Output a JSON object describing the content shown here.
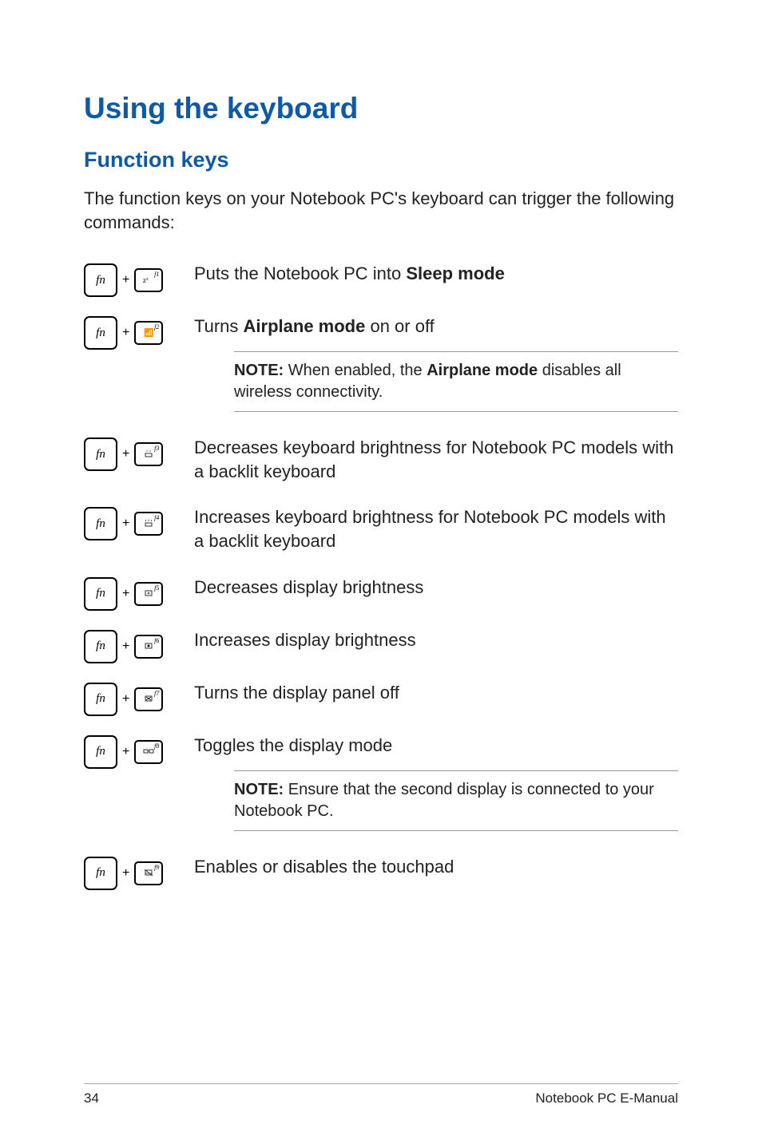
{
  "title": "Using the keyboard",
  "section_title": "Function keys",
  "intro": "The function keys on your Notebook PC's keyboard can trigger the following commands:",
  "rows": [
    {
      "fkey": "f1",
      "desc_prefix": "Puts the Notebook PC into ",
      "desc_bold": "Sleep mode",
      "desc_suffix": ""
    },
    {
      "fkey": "f2",
      "desc_prefix": "Turns ",
      "desc_bold": "Airplane mode",
      "desc_suffix": " on or off",
      "note_prefix": "NOTE:",
      "note_mid1": " When enabled, the ",
      "note_bold": "Airplane mode",
      "note_mid2": " disables all wireless connectivity."
    },
    {
      "fkey": "f3",
      "desc_prefix": "Decreases keyboard brightness for Notebook PC models with a backlit keyboard",
      "desc_bold": "",
      "desc_suffix": ""
    },
    {
      "fkey": "f4",
      "desc_prefix": "Increases keyboard brightness for Notebook PC models with a backlit keyboard",
      "desc_bold": "",
      "desc_suffix": ""
    },
    {
      "fkey": "f5",
      "desc_prefix": "Decreases display brightness",
      "desc_bold": "",
      "desc_suffix": ""
    },
    {
      "fkey": "f6",
      "desc_prefix": "Increases display brightness",
      "desc_bold": "",
      "desc_suffix": ""
    },
    {
      "fkey": "f7",
      "desc_prefix": "Turns the display panel off",
      "desc_bold": "",
      "desc_suffix": ""
    },
    {
      "fkey": "f8",
      "desc_prefix": "Toggles the display mode",
      "desc_bold": "",
      "desc_suffix": "",
      "note_prefix": "NOTE:",
      "note_mid1": " Ensure that the second display is connected to your Notebook PC.",
      "note_bold": "",
      "note_mid2": ""
    },
    {
      "fkey": "f9",
      "desc_prefix": "Enables or disables the touchpad",
      "desc_bold": "",
      "desc_suffix": ""
    }
  ],
  "fn_label": "fn",
  "plus": "+",
  "footer_page": "34",
  "footer_title": "Notebook PC E-Manual",
  "icons": {
    "f1": "z-icon",
    "f2": "wifi-icon",
    "f3": "keyboard-dim-icon",
    "f4": "keyboard-bright-icon",
    "f5": "brightness-down-icon",
    "f6": "brightness-up-icon",
    "f7": "display-off-icon",
    "f8": "display-toggle-icon",
    "f9": "touchpad-icon"
  }
}
